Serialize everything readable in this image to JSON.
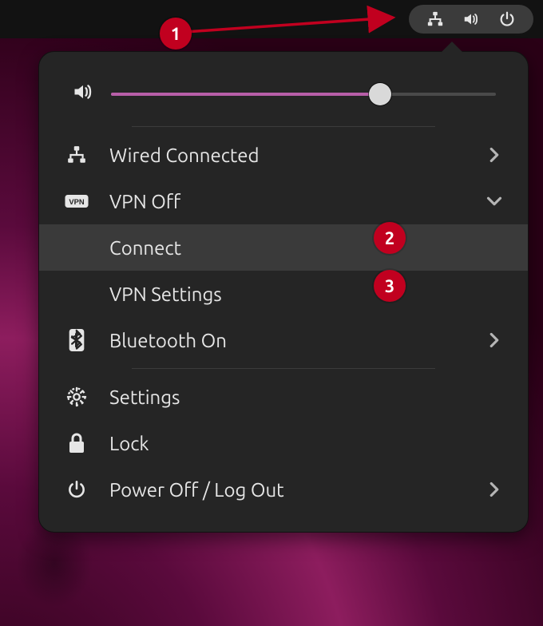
{
  "menu": {
    "volume_percent": 70,
    "items": {
      "wired": {
        "label": "Wired Connected"
      },
      "vpn": {
        "label": "VPN Off"
      },
      "connect": {
        "label": "Connect"
      },
      "vpnset": {
        "label": "VPN Settings"
      },
      "bluetooth": {
        "label": "Bluetooth On"
      },
      "settings": {
        "label": "Settings"
      },
      "lock": {
        "label": "Lock"
      },
      "power": {
        "label": "Power Off / Log Out"
      }
    }
  },
  "annotations": {
    "c1": "1",
    "c2": "2",
    "c3": "3"
  }
}
